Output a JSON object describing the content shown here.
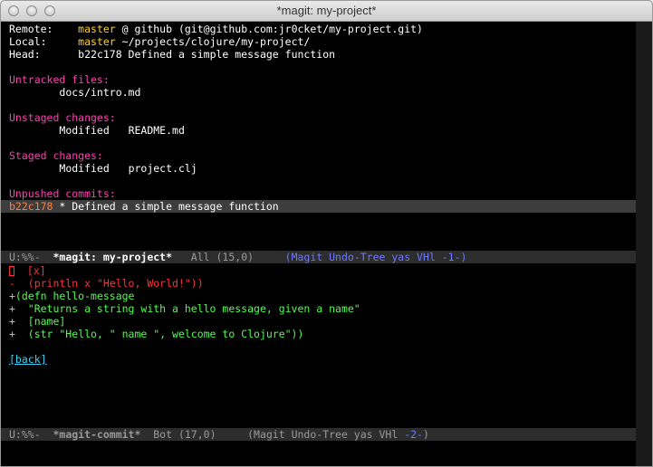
{
  "window": {
    "title": "*magit: my-project*"
  },
  "status": {
    "remote_label": "Remote:",
    "remote_branch": "master",
    "remote_rest": " @ github (git@github.com:jr0cket/my-project.git)",
    "local_label": "Local:",
    "local_branch": "master",
    "local_rest": " ~/projects/clojure/my-project/",
    "head_label": "Head:",
    "head_rest": "b22c178 Defined a simple message function"
  },
  "sections": {
    "untracked_heading": "Untracked files:",
    "untracked_file": "docs/intro.md",
    "unstaged_heading": "Unstaged changes:",
    "unstaged_status": "Modified",
    "unstaged_file": "README.md",
    "staged_heading": "Staged changes:",
    "staged_status": "Modified",
    "staged_file": "project.clj",
    "unpushed_heading": "Unpushed commits:",
    "unpushed_hash": "b22c178",
    "unpushed_message": " * Defined a simple message function"
  },
  "modeline_top": {
    "prefix": "U:%%-  ",
    "buffer": "*magit: my-project*",
    "position": "   All (15,0)     ",
    "modes": "(Magit Undo-Tree yas VHl -1-)"
  },
  "diff": {
    "line1": "  [x]",
    "line2": "-  (println x \"Hello, World!\"))",
    "line3": "+(defn hello-message",
    "line4": "+  \"Returns a string with a hello message, given a name\"",
    "line5": "+  [name]",
    "line6": "+  (str \"Hello, \" name \", welcome to Clojure\"))",
    "back_link": "[back]"
  },
  "modeline_bottom": {
    "prefix": "U:%%-  ",
    "buffer": "*magit-commit*",
    "position": "  Bot (17,0)     ",
    "modes_pre": "(Magit Undo-Tree yas VHl ",
    "modes_num": "-2-",
    "modes_post": ")"
  },
  "colors": {
    "heading": "#ff3fb4",
    "branch": "#ffd21f",
    "hash": "#ff7f3f",
    "added": "#4dff4d",
    "removed": "#ff3434",
    "link": "#33d6ff"
  }
}
